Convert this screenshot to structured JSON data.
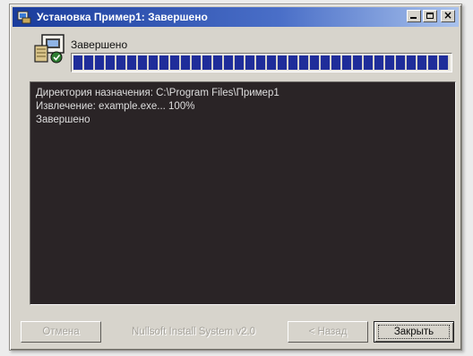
{
  "window": {
    "title": "Установка Пример1: Завершено",
    "icon": "installer-icon"
  },
  "status": {
    "label": "Завершено",
    "progress_percent": 100,
    "icon": "installer-package-icon"
  },
  "log": {
    "lines": [
      "Директория назначения: C:\\Program Files\\Пример1",
      "Извлечение: example.exe... 100%",
      "Завершено"
    ]
  },
  "footer": {
    "cancel_label": "Отмена",
    "brand_text": "Nullsoft Install System v2.0",
    "back_label": "< Назад",
    "close_label": "Закрыть"
  },
  "colors": {
    "titlebar_start": "#1a3c9c",
    "progress": "#1f2d9a",
    "log_background": "#2a2426",
    "log_text": "#dedede"
  }
}
